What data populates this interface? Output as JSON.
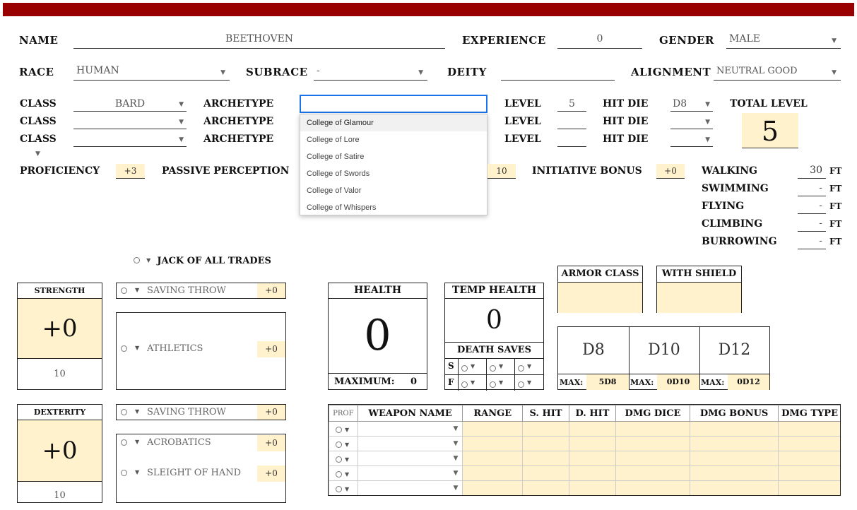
{
  "colors": {
    "header_bar": "#990000",
    "cream": "#fff2cc",
    "focus": "#1a73e8"
  },
  "row1": {
    "name_label": "Name",
    "name_value": "Beethoven",
    "experience_label": "Experience",
    "experience_value": "0",
    "gender_label": "Gender",
    "gender_value": "Male"
  },
  "row2": {
    "race_label": "Race",
    "race_value": "Human",
    "subrace_label": "Subrace",
    "subrace_value": "-",
    "deity_label": "Deity",
    "deity_value": "",
    "alignment_label": "Alignment",
    "alignment_value": "Neutral Good"
  },
  "classes": {
    "class_label": "Class",
    "archetype_label": "Archetype",
    "level_label": "Level",
    "hit_die_label": "Hit Die",
    "rows": [
      {
        "class": "Bard",
        "archetype": "",
        "level": "5",
        "hit_die": "d8"
      },
      {
        "class": "",
        "archetype": "",
        "level": "",
        "hit_die": ""
      },
      {
        "class": "",
        "archetype": "",
        "level": "",
        "hit_die": ""
      }
    ],
    "total_level_label": "Total Level",
    "total_level": "5"
  },
  "archetype_menu": {
    "options": [
      "College of Glamour",
      "College of Lore",
      "College of Satire",
      "College of Swords",
      "College of Valor",
      "College of Whispers"
    ]
  },
  "row4": {
    "proficiency_label": "Proficiency",
    "proficiency_value": "+3",
    "passive_label": "Passive Perception",
    "passive_value": "10",
    "initiative_label": "Initiative Bonus",
    "initiative_value": "+0"
  },
  "movement": {
    "unit": "ft",
    "items": [
      {
        "label": "Walking",
        "value": "30"
      },
      {
        "label": "Swimming",
        "value": "-"
      },
      {
        "label": "Flying",
        "value": "-"
      },
      {
        "label": "Climbing",
        "value": "-"
      },
      {
        "label": "Burrowing",
        "value": "-"
      }
    ]
  },
  "jack_label": "Jack of All Trades",
  "strength": {
    "label": "Strength",
    "modifier": "+0",
    "score": "10",
    "saving_throw_label": "Saving Throw",
    "saving_throw_bonus": "+0",
    "skills": [
      {
        "name": "Athletics",
        "bonus": "+0"
      }
    ]
  },
  "dexterity": {
    "label": "Dexterity",
    "modifier": "+0",
    "score": "10",
    "saving_throw_label": "Saving Throw",
    "saving_throw_bonus": "+0",
    "skills": [
      {
        "name": "Acrobatics",
        "bonus": "+0"
      },
      {
        "name": "Sleight of Hand",
        "bonus": "+0"
      }
    ]
  },
  "health": {
    "label": "Health",
    "value": "0",
    "max_label": "Maximum:",
    "max_value": "0"
  },
  "temp_health": {
    "label": "Temp Health",
    "value": "0"
  },
  "death_saves": {
    "label": "Death Saves",
    "success": "S",
    "fail": "F"
  },
  "armor": {
    "ac_label": "Armor Class",
    "shield_label": "With Shield"
  },
  "hit_dice": {
    "max_label": "Max:",
    "dice": [
      {
        "die": "d8",
        "max": "5d8"
      },
      {
        "die": "d10",
        "max": "0d10"
      },
      {
        "die": "d12",
        "max": "0d12"
      }
    ]
  },
  "weapons": {
    "headers": [
      "Prof",
      "Weapon Name",
      "Range",
      "S. Hit",
      "D. Hit",
      "Dmg Dice",
      "Dmg Bonus",
      "Dmg Type"
    ],
    "row_count": 5
  }
}
